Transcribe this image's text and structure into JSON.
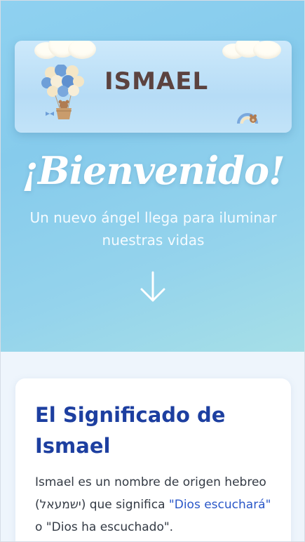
{
  "banner": {
    "name": "ISMAEL",
    "balloons_icon": "hot-air-balloon-teddy-bear",
    "rainbow_icon": "rainbow-teddy-bear"
  },
  "hero": {
    "welcome": "¡Bienvenido!",
    "subtitle": "Un nuevo ángel llega para iluminar nuestras vidas",
    "arrow_icon": "arrow-down-icon"
  },
  "meaning": {
    "title": "El Significado de Ismael",
    "body_before": "Ismael es un nombre de origen hebreo (ישמעאל) que significa ",
    "highlight": "\"Dios escuchará\"",
    "body_after": " o \"Dios ha escuchado\"."
  },
  "colors": {
    "hero_bg": "#8fd1f0",
    "banner_text": "#5c4340",
    "title": "#1d3fa0",
    "highlight": "#2a57c8"
  }
}
